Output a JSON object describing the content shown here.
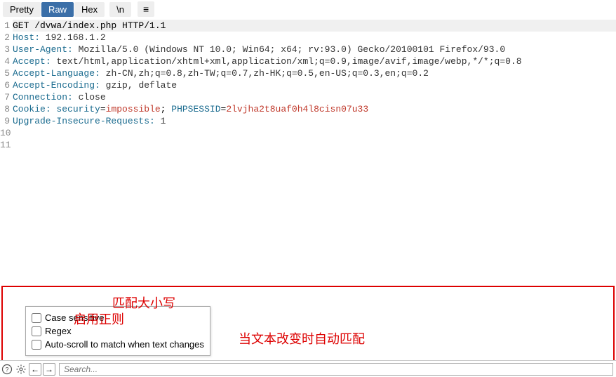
{
  "toolbar": {
    "tabs": [
      "Pretty",
      "Raw",
      "Hex"
    ],
    "active_tab": 1,
    "newline_btn": "\\n",
    "menu_icon": "≡"
  },
  "request": {
    "start_line": "GET /dvwa/index.php HTTP/1.1",
    "headers": [
      {
        "name": "Host",
        "value": "192.168.1.2"
      },
      {
        "name": "User-Agent",
        "value": "Mozilla/5.0 (Windows NT 10.0; Win64; x64; rv:93.0) Gecko/20100101 Firefox/93.0"
      },
      {
        "name": "Accept",
        "value": "text/html,application/xhtml+xml,application/xml;q=0.9,image/avif,image/webp,*/*;q=0.8"
      },
      {
        "name": "Accept-Language",
        "value": "zh-CN,zh;q=0.8,zh-TW;q=0.7,zh-HK;q=0.5,en-US;q=0.3,en;q=0.2"
      },
      {
        "name": "Accept-Encoding",
        "value": "gzip, deflate"
      },
      {
        "name": "Connection",
        "value": "close"
      }
    ],
    "cookie": {
      "name": "Cookie",
      "params": [
        {
          "key": "security",
          "value": "impossible"
        },
        {
          "key": "PHPSESSID",
          "value": "2lvjha2t8uaf0h4l8cisn07u33"
        }
      ]
    },
    "upgrade": {
      "name": "Upgrade-Insecure-Requests",
      "value": "1"
    },
    "blank_lines": 2
  },
  "popup": {
    "case_sensitive": "Case sensitive",
    "regex": "Regex",
    "autoscroll": "Auto-scroll to match when text changes"
  },
  "annotations": {
    "case": "匹配大小写",
    "regex": "启用正则",
    "autoscroll": "当文本改变时自动匹配"
  },
  "searchbar": {
    "placeholder": "Search..."
  }
}
